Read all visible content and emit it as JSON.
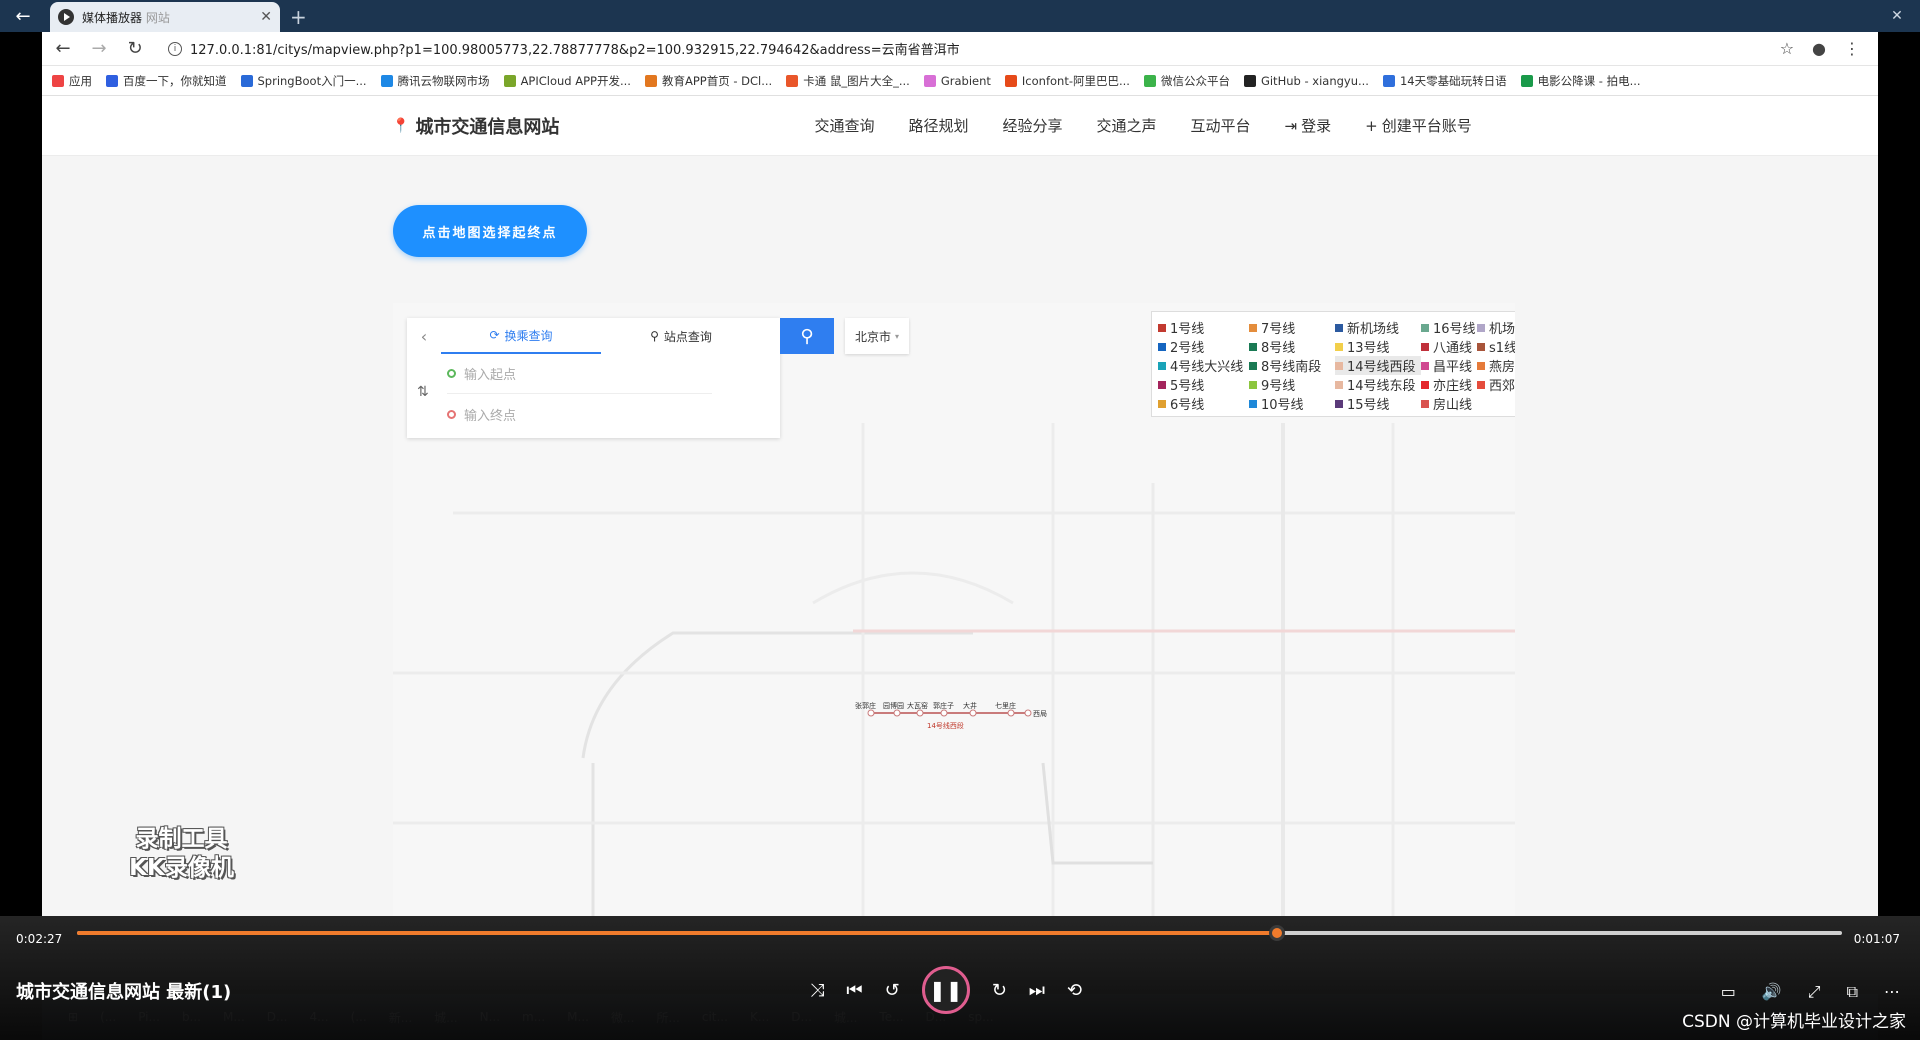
{
  "player": {
    "back_icon": "arrow-left-icon",
    "window_controls": [
      "minimize-icon",
      "restore-icon",
      "close-icon"
    ],
    "time_elapsed": "0:02:27",
    "time_remaining": "0:01:07",
    "progress_fraction": 0.68,
    "title": "城市交通信息网站 最新(1)",
    "watermark_line1": "录制工具",
    "watermark_line2": "KK录像机",
    "csdn_credit": "CSDN @计算机毕业设计之家",
    "accent_color": "#f07b2c"
  },
  "browser": {
    "tab_title": "媒体播放器",
    "tab_sub": "网站",
    "new_tab": "+",
    "url": "127.0.0.1:81/citys/mapview.php?p1=100.98005773,22.78877778&p2=100.932915,22.794642&address=云南省普洱市",
    "bookmarks": [
      {
        "label": "应用",
        "color": "#e44"
      },
      {
        "label": "百度一下，你就知道",
        "color": "#2f5fe0"
      },
      {
        "label": "SpringBoot入门一...",
        "color": "#2a6ad8"
      },
      {
        "label": "腾讯云物联网市场",
        "color": "#1e88e5"
      },
      {
        "label": "APICloud APP开发...",
        "color": "#7aa62a"
      },
      {
        "label": "教育APP首页 - DCl...",
        "color": "#e2771f"
      },
      {
        "label": "卡通 鼠_图片大全_...",
        "color": "#e9562a"
      },
      {
        "label": "Grabient",
        "color": "#d86fd6"
      },
      {
        "label": "Iconfont-阿里巴巴...",
        "color": "#e64a19"
      },
      {
        "label": "微信公众平台",
        "color": "#3bb34a"
      },
      {
        "label": "GitHub - xiangyu...",
        "color": "#222"
      },
      {
        "label": "14天零基础玩转日语",
        "color": "#2f6fdc"
      },
      {
        "label": "电影公降课 - 拍电...",
        "color": "#1a9a4a"
      }
    ]
  },
  "site": {
    "logo": "城市交通信息网站",
    "nav": [
      "交通查询",
      "路径规划",
      "经验分享",
      "交通之声",
      "互动平台",
      "登录",
      "创建平台账号"
    ],
    "pick_button": "点击地图选择起终点",
    "search": {
      "tab_transfer": "换乘查询",
      "tab_station": "站点查询",
      "start_placeholder": "输入起点",
      "end_placeholder": "输入终点",
      "city": "北京市"
    },
    "legend": [
      {
        "label": "1号线",
        "color": "#c23a30"
      },
      {
        "label": "7号线",
        "color": "#e48d3c"
      },
      {
        "label": "新机场线",
        "color": "#2c5aa0"
      },
      {
        "label": "16号线",
        "color": "#6aa88f"
      },
      {
        "label": "机场线",
        "color": "#b0a6c8"
      },
      {
        "label": "2号线",
        "color": "#1565c0"
      },
      {
        "label": "8号线",
        "color": "#1a7a54"
      },
      {
        "label": "13号线",
        "color": "#f2cf4a"
      },
      {
        "label": "八通线",
        "color": "#c0303b"
      },
      {
        "label": "s1线",
        "color": "#a8543a"
      },
      {
        "label": "4号线大兴线",
        "color": "#1aa3b8"
      },
      {
        "label": "8号线南段",
        "color": "#1a7a54"
      },
      {
        "label": "14号线西段",
        "color": "#e7b8a0"
      },
      {
        "label": "昌平线",
        "color": "#d04890"
      },
      {
        "label": "燕房线",
        "color": "#e57a3a"
      },
      {
        "label": "5号线",
        "color": "#a4245c"
      },
      {
        "label": "9号线",
        "color": "#8cc63e"
      },
      {
        "label": "14号线东段",
        "color": "#e7b8a0"
      },
      {
        "label": "亦庄线",
        "color": "#e4262b"
      },
      {
        "label": "西郊线",
        "color": "#e54c3c"
      },
      {
        "label": "6号线",
        "color": "#e0a030"
      },
      {
        "label": "10号线",
        "color": "#1e88d8"
      },
      {
        "label": "15号线",
        "color": "#5b3a7a"
      },
      {
        "label": "房山线",
        "color": "#d9534f"
      }
    ],
    "highlight_line": {
      "name": "14号线西段",
      "stations": [
        "张郭庄",
        "园博园",
        "大瓦窑",
        "郭庄子",
        "大井",
        "七里庄",
        "西局"
      ]
    }
  },
  "taskbar": [
    "(...",
    "Pi...",
    "b...",
    "M...",
    "D...",
    "4...",
    "(...",
    "新...",
    "城...",
    "N...",
    "m...",
    "M...",
    "微...",
    "所...",
    "cit...",
    "K...",
    "D...",
    "城...",
    "Te...",
    "D...",
    "sp..."
  ]
}
